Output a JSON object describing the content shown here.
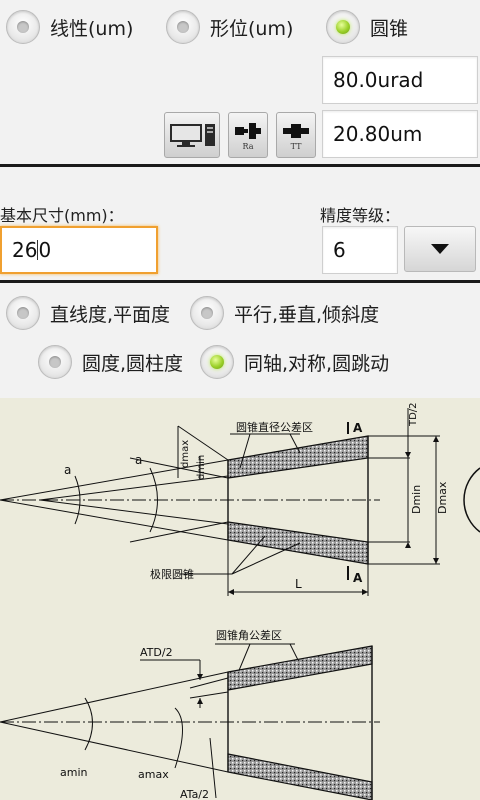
{
  "mode_radios": [
    {
      "label": "线性(um)",
      "checked": false
    },
    {
      "label": "形位(um)",
      "checked": false
    },
    {
      "label": "圆锥",
      "checked": true
    }
  ],
  "results": {
    "angle_value": "80.0urad",
    "dia_value": "20.80um"
  },
  "toolbar": {
    "ra_label": "Ra",
    "tt_label": "TT"
  },
  "basic_size": {
    "label": "基本尺寸(mm)：",
    "value_before_cursor": "26",
    "value_after_cursor": "0"
  },
  "precision": {
    "label": "精度等级：",
    "value": "6"
  },
  "tolerance_radios": [
    {
      "label": "直线度,平面度",
      "checked": false
    },
    {
      "label": "平行,垂直,倾斜度",
      "checked": false
    },
    {
      "label": "圆度,圆柱度",
      "checked": false
    },
    {
      "label": "同轴,对称,圆跳动",
      "checked": true
    }
  ],
  "diagram_labels": {
    "zone_diameter": "圆锥直径公差区",
    "limit_cone": "极限圆锥",
    "zone_angle": "圆锥角公差区",
    "section_a": "A",
    "td_half": "TD/2",
    "dmax": "dmax",
    "dmin": "dmin",
    "Dmin": "Dmin",
    "Dmax": "Dmax",
    "L": "L",
    "alpha": "a",
    "atd_half": "ATD/2",
    "ata_half": "ATa/2",
    "alpha_min": "amin",
    "alpha_max": "amax"
  },
  "colors": {
    "accent_green": "#9bd02a",
    "focus_orange": "#f0a030",
    "divider": "#1a1a1a",
    "drawing_bg": "#ecebdc"
  }
}
